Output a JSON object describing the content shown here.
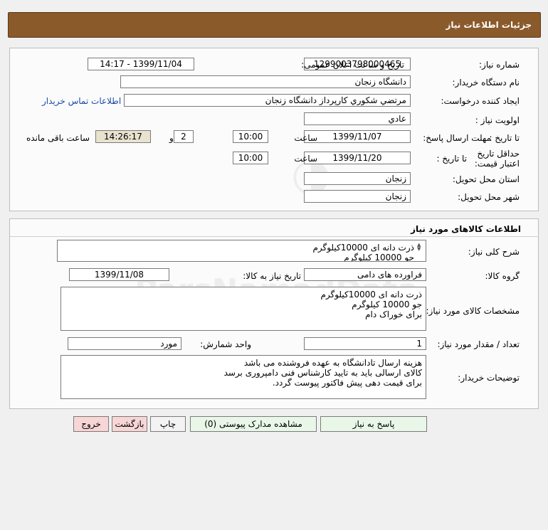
{
  "header": {
    "title": "جزئیات اطلاعات نیاز"
  },
  "need_info": {
    "need_number_label": "شماره نیاز:",
    "need_number": "1299003798000465",
    "announce_label": "تاریخ و ساعت اعلان عمومی:",
    "announce_value": "1399/11/04 - 14:17",
    "buyer_org_label": "نام دستگاه خریدار:",
    "buyer_org": "دانشگاه زنجان",
    "requester_label": "ایجاد کننده درخواست:",
    "requester": "مرتضي شكوري كارپرداز دانشگاه زنجان",
    "contact_link": "اطلاعات تماس خریدار",
    "priority_label": "اولویت نیاز :",
    "priority": "عادي",
    "reply_deadline_label": "مهلت ارسال پاسخ:",
    "to_date_label": "تا تاریخ :",
    "reply_date": "1399/11/07",
    "hour_label": "ساعت",
    "reply_time": "10:00",
    "days_value": "2",
    "days_label": "روز و",
    "remaining_time": "14:26:17",
    "remaining_label": "ساعت باقی مانده",
    "price_validity_label": "حداقل تاریخ اعتبار قیمت:",
    "price_to_date_label": "تا تاریخ :",
    "price_date": "1399/11/20",
    "price_hour_label": "ساعت",
    "price_time": "10:00",
    "province_label": "استان محل تحویل:",
    "province": "زنجان",
    "city_label": "شهر محل تحویل:",
    "city": "زنجان"
  },
  "goods": {
    "section_title": "اطلاعات کالاهای مورد نیاز",
    "general_desc_label": "شرح کلی نیاز:",
    "general_desc": "ذرت دانه ای 10000کیلوگرم\nجو 10000 کیلوگرم",
    "group_label": "گروه کالا:",
    "group": "فراورده های دامی",
    "need_date_label": "تاریخ نیاز به کالا:",
    "need_date": "1399/11/08",
    "specs_label": "مشخصات کالای مورد نیاز:",
    "specs": "ذرت دانه ای 10000کیلوگرم\nجو 10000 کیلوگرم\nبرای خوراک دام",
    "qty_label": "تعداد / مقدار مورد نیاز:",
    "qty": "1",
    "unit_label": "واحد شمارش:",
    "unit": "مورد",
    "buyer_notes_label": "توضیحات خریدار:",
    "buyer_notes": "هزینه ارسال تادانشگاه به عهده فروشنده می باشد\nکالای ارسالی باید به تایید کارشناس فنی دامپروری برسد\nبرای قیمت دهی پیش فاکتور پیوست گردد."
  },
  "buttons": {
    "reply": "پاسخ به نیاز",
    "attachments": "مشاهده مدارک پیوستی (0)",
    "print": "چاپ",
    "back": "بازگشت",
    "exit": "خروج"
  }
}
